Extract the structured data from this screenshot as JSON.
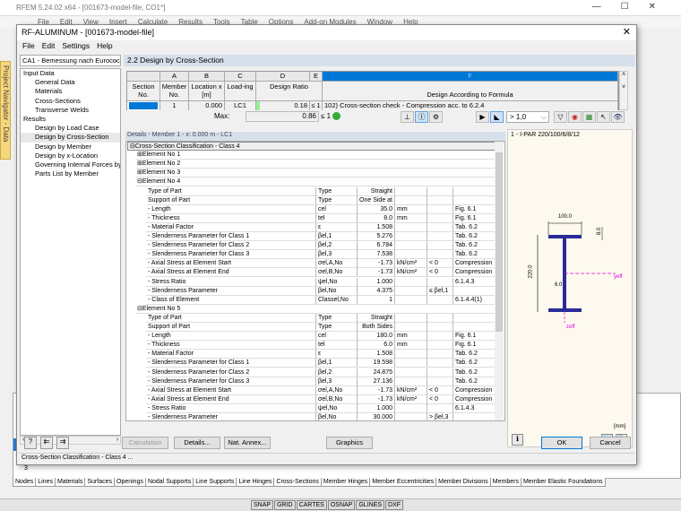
{
  "app": {
    "title": "RFEM 5.24.02 x64 - [001673-model-file, CO1*]",
    "menu": [
      "File",
      "Edit",
      "View",
      "Insert",
      "Calculate",
      "Results",
      "Tools",
      "Table",
      "Options",
      "Add-on Modules",
      "Window",
      "Help"
    ],
    "navigator_tab": "Project Navigator - Data"
  },
  "dialog": {
    "title": "RF-ALUMINUM - [001673-model-file]",
    "menu": [
      "File",
      "Edit",
      "Settings",
      "Help"
    ],
    "case_combo": "CA1 - Bemessung nach Eurococ",
    "tree": [
      {
        "label": "Input Data",
        "level": 1
      },
      {
        "label": "General Data",
        "level": 2
      },
      {
        "label": "Materials",
        "level": 2
      },
      {
        "label": "Cross-Sections",
        "level": 2
      },
      {
        "label": "Transverse Welds",
        "level": 2
      },
      {
        "label": "Results",
        "level": 1
      },
      {
        "label": "Design by Load Case",
        "level": 2
      },
      {
        "label": "Design by Cross-Section",
        "level": 2,
        "selected": true
      },
      {
        "label": "Design by Member",
        "level": 2
      },
      {
        "label": "Design by x-Location",
        "level": 2
      },
      {
        "label": "Governing Internal Forces by M",
        "level": 2
      },
      {
        "label": "Parts List by Member",
        "level": 2
      }
    ],
    "section_title": "2.2 Design by Cross-Section",
    "table": {
      "col_letters": [
        "A",
        "B",
        "C",
        "D",
        "E",
        "F"
      ],
      "headers": [
        "Section No.",
        "Member No.",
        "Location x [m]",
        "Load-ing",
        "Design Ratio",
        "",
        "Design According to Formula"
      ],
      "row": {
        "member": "1",
        "location": "0.000",
        "loading": "LC1",
        "ratio": "0.18",
        "le": "≤ 1",
        "formula": "102) Cross-section check - Compression acc. to 6.2.4"
      }
    },
    "max_label": "Max:",
    "max_value": "0.86",
    "max_le": "≤ 1",
    "filter": "> 1,0",
    "details_title": "Details - Member 1 - x: 0.000 m - LC1",
    "details": [
      {
        "t": "g",
        "name": "Cross-Section Classification - Class 4",
        "exp": "⊟"
      },
      {
        "t": "e",
        "name": "Element No 1",
        "exp": "⊞"
      },
      {
        "t": "e",
        "name": "Element No 2",
        "exp": "⊞"
      },
      {
        "t": "e",
        "name": "Element No 3",
        "exp": "⊞"
      },
      {
        "t": "e",
        "name": "Element No 4",
        "exp": "⊟"
      },
      {
        "t": "r",
        "name": "Type of Part",
        "sym": "Type",
        "val": "Straight",
        "unit": "",
        "cond": "",
        "ref": ""
      },
      {
        "t": "r",
        "name": "Support of Part",
        "sym": "Type",
        "val": "One Side at",
        "unit": "",
        "cond": "",
        "ref": ""
      },
      {
        "t": "r",
        "name": "- Length",
        "sym": "cel",
        "val": "35.0",
        "unit": "mm",
        "cond": "",
        "ref": "Fig. 6.1"
      },
      {
        "t": "r",
        "name": "- Thickness",
        "sym": "tel",
        "val": "8.0",
        "unit": "mm",
        "cond": "",
        "ref": "Fig. 6.1"
      },
      {
        "t": "r",
        "name": "- Material Factor",
        "sym": "ε",
        "val": "1.508",
        "unit": "",
        "cond": "",
        "ref": "Tab. 6.2"
      },
      {
        "t": "r",
        "name": "- Slenderness Parameter for Class 1",
        "sym": "βel,1",
        "val": "5.276",
        "unit": "",
        "cond": "",
        "ref": "Tab. 6.2"
      },
      {
        "t": "r",
        "name": "- Slenderness Parameter for Class 2",
        "sym": "βel,2",
        "val": "6.784",
        "unit": "",
        "cond": "",
        "ref": "Tab. 6.2"
      },
      {
        "t": "r",
        "name": "- Slenderness Parameter for Class 3",
        "sym": "βel,3",
        "val": "7.538",
        "unit": "",
        "cond": "",
        "ref": "Tab. 6.2"
      },
      {
        "t": "r",
        "name": "- Axial Stress at Element Start",
        "sym": "σel,A,No",
        "val": "-1.73",
        "unit": "kN/cm²",
        "cond": "< 0",
        "ref": "Compression"
      },
      {
        "t": "r",
        "name": "- Axial Stress at Element End",
        "sym": "σel,B,No",
        "val": "-1.73",
        "unit": "kN/cm²",
        "cond": "< 0",
        "ref": "Compression"
      },
      {
        "t": "r",
        "name": "- Stress Ratio",
        "sym": "ψel,No",
        "val": "1.000",
        "unit": "",
        "cond": "",
        "ref": "6.1.4.3"
      },
      {
        "t": "r",
        "name": "- Slenderness Parameter",
        "sym": "βel,No",
        "val": "4.375",
        "unit": "",
        "cond": "≤ βel,1",
        "ref": ""
      },
      {
        "t": "r",
        "name": "- Class of Element",
        "sym": "Classel,No",
        "val": "1",
        "unit": "",
        "cond": "",
        "ref": "6.1.4.4(1)"
      },
      {
        "t": "e",
        "name": "Element No 5",
        "exp": "⊟"
      },
      {
        "t": "r",
        "name": "Type of Part",
        "sym": "Type",
        "val": "Straight",
        "unit": "",
        "cond": "",
        "ref": ""
      },
      {
        "t": "r",
        "name": "Support of Part",
        "sym": "Type",
        "val": "Both Sides",
        "unit": "",
        "cond": "",
        "ref": ""
      },
      {
        "t": "r",
        "name": "- Length",
        "sym": "cel",
        "val": "180.0",
        "unit": "mm",
        "cond": "",
        "ref": "Fig. 6.1"
      },
      {
        "t": "r",
        "name": "- Thickness",
        "sym": "tel",
        "val": "6.0",
        "unit": "mm",
        "cond": "",
        "ref": "Fig. 6.1"
      },
      {
        "t": "r",
        "name": "- Material Factor",
        "sym": "ε",
        "val": "1.508",
        "unit": "",
        "cond": "",
        "ref": "Tab. 6.2"
      },
      {
        "t": "r",
        "name": "- Slenderness Parameter for Class 1",
        "sym": "βel,1",
        "val": "19.598",
        "unit": "",
        "cond": "",
        "ref": "Tab. 6.2"
      },
      {
        "t": "r",
        "name": "- Slenderness Parameter for Class 2",
        "sym": "βel,2",
        "val": "24.875",
        "unit": "",
        "cond": "",
        "ref": "Tab. 6.2"
      },
      {
        "t": "r",
        "name": "- Slenderness Parameter for Class 3",
        "sym": "βel,3",
        "val": "27.136",
        "unit": "",
        "cond": "",
        "ref": "Tab. 6.2"
      },
      {
        "t": "r",
        "name": "- Axial Stress at Element Start",
        "sym": "σel,A,No",
        "val": "-1.73",
        "unit": "kN/cm²",
        "cond": "< 0",
        "ref": "Compression"
      },
      {
        "t": "r",
        "name": "- Axial Stress at Element End",
        "sym": "σel,B,No",
        "val": "-1.73",
        "unit": "kN/cm²",
        "cond": "< 0",
        "ref": "Compression"
      },
      {
        "t": "r",
        "name": "- Stress Ratio",
        "sym": "ψel,No",
        "val": "1.000",
        "unit": "",
        "cond": "",
        "ref": "6.1.4.3"
      },
      {
        "t": "r",
        "name": "- Slenderness Parameter",
        "sym": "βel,No",
        "val": "30.000",
        "unit": "",
        "cond": "> βel,3",
        "ref": ""
      }
    ],
    "graphic": {
      "title": "1 - I-PAR 220/100/6/8/12",
      "width_dim": "100.0",
      "height_dim": "220.0",
      "flange_dim": "8.0",
      "web_dim": "6.0",
      "y_axis": "yeff",
      "z_axis": "zeff",
      "unit": "[mm]"
    },
    "buttons": {
      "calculation": "Calculation",
      "details": "Details...",
      "nat_annex": "Nat. Annex...",
      "graphics": "Graphics",
      "ok": "OK",
      "cancel": "Cancel"
    },
    "status": "Cross-Section Classification - Class 4 ..."
  },
  "bg": {
    "row_no": "3",
    "tabs": [
      "Nodes",
      "Lines",
      "Materials",
      "Surfaces",
      "Openings",
      "Nodal Supports",
      "Line Supports",
      "Line Hinges",
      "Cross-Sections",
      "Member Hinges",
      "Member Eccentricities",
      "Member Divisions",
      "Members",
      "Member Elastic Foundations"
    ],
    "status_toggles": [
      "SNAP",
      "GRID",
      "CARTES",
      "OSNAP",
      "GLINES",
      "DXF"
    ]
  },
  "colors": {
    "accent": "#0078d7",
    "section_header": "#d7e0ea",
    "graphic_bg": "#fdf9ee",
    "section_fill": "#2a2a9a",
    "axis": "#e000e0"
  }
}
